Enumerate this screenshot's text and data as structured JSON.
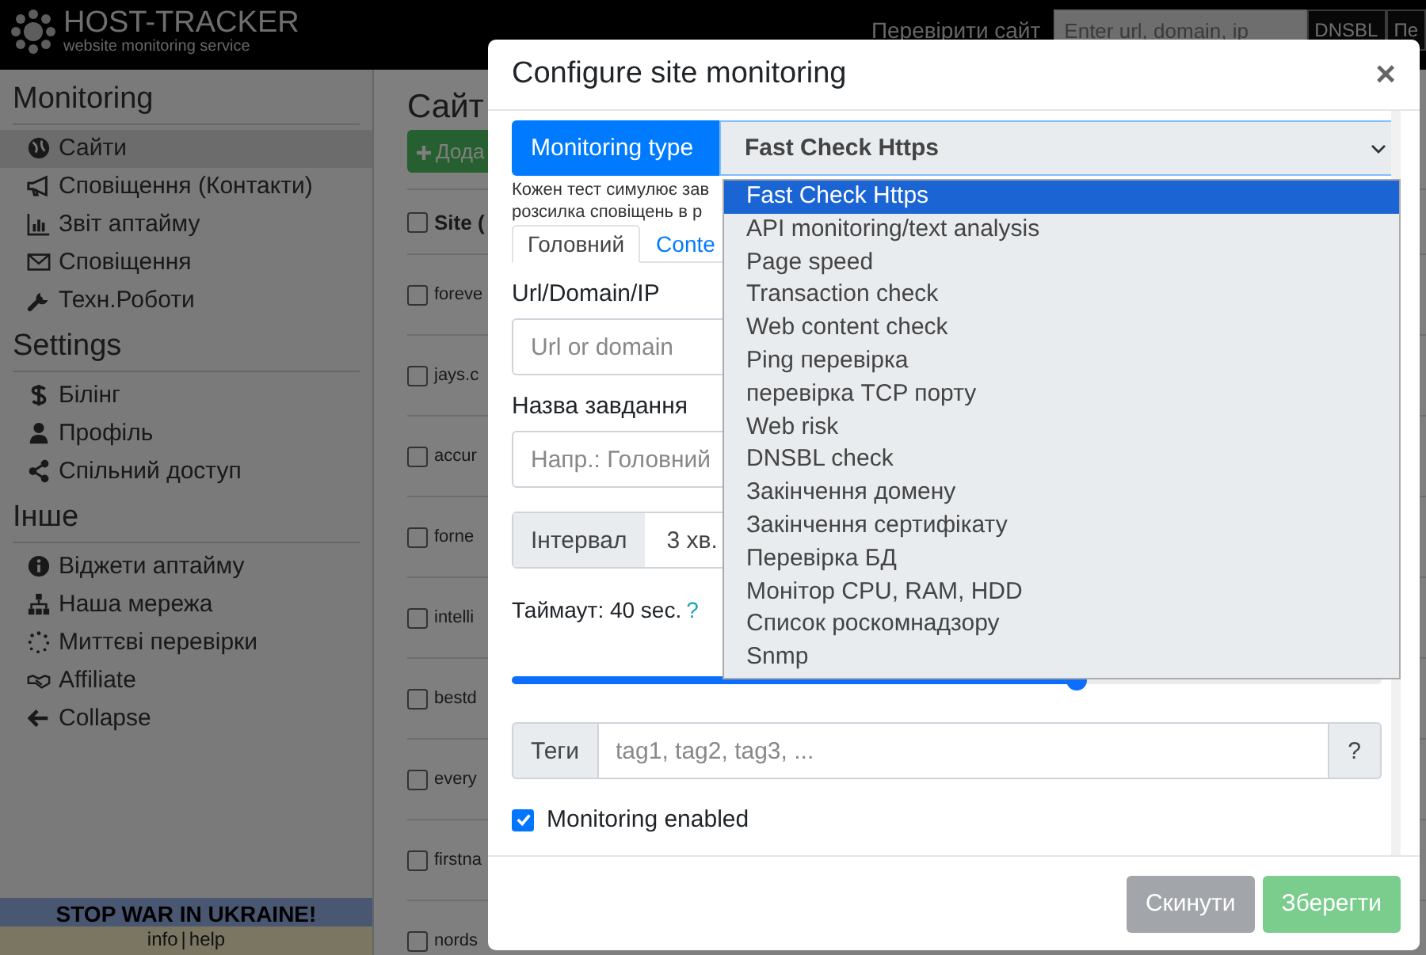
{
  "header": {
    "logo_title": "HOST-TRACKER",
    "logo_subtitle": "website monitoring service",
    "check_label": "Перевірити сайт",
    "check_placeholder": "Enter url, domain, ip",
    "buttons": [
      "DNSBL",
      "Пе"
    ]
  },
  "sidebar": {
    "sections": [
      {
        "title": "Monitoring",
        "items": [
          {
            "label": "Сайти",
            "selected": true
          },
          {
            "label": "Сповіщення (Контакти)",
            "selected": false
          },
          {
            "label": "Звіт аптайму",
            "selected": false
          },
          {
            "label": "Сповіщення",
            "selected": false
          },
          {
            "label": "Техн.Роботи",
            "selected": false
          }
        ]
      },
      {
        "title": "Settings",
        "items": [
          {
            "label": "Білінг",
            "selected": false
          },
          {
            "label": "Профіль",
            "selected": false
          },
          {
            "label": "Спільний доступ",
            "selected": false
          }
        ]
      },
      {
        "title": "Інше",
        "items": [
          {
            "label": "Віджети аптайму",
            "selected": false
          },
          {
            "label": "Наша мережа",
            "selected": false
          },
          {
            "label": "Миттєві перевірки",
            "selected": false
          },
          {
            "label": "Affiliate",
            "selected": false
          },
          {
            "label": "Collapse",
            "selected": false
          }
        ]
      }
    ],
    "banner": {
      "title": "STOP WAR IN UKRAINE!",
      "links": [
        "info",
        "help"
      ],
      "separator": "|"
    }
  },
  "main": {
    "title": "Сайт",
    "add_button": "Дода",
    "column": "Site (",
    "all_checked": false,
    "rows": [
      {
        "site": "foreve",
        "checked": false
      },
      {
        "site": "jays.c",
        "checked": false
      },
      {
        "site": "accur",
        "checked": false
      },
      {
        "site": "forne",
        "checked": false
      },
      {
        "site": "intelli",
        "checked": false
      },
      {
        "site": "bestd",
        "checked": false
      },
      {
        "site": "every",
        "checked": false
      },
      {
        "site": "firstna",
        "checked": false
      },
      {
        "site": "nords",
        "checked": false
      }
    ]
  },
  "modal": {
    "title": "Configure site monitoring",
    "close": "×",
    "type_label": "Monitoring type",
    "type_value": "Fast Check Https",
    "help_lines": [
      "Кожен тест симулює зав",
      "розсилка сповіщень в р"
    ],
    "tabs": [
      {
        "label": "Головний",
        "selected": true
      },
      {
        "label": "Conte",
        "selected": false
      }
    ],
    "url_label": "Url/Domain/IP",
    "url_placeholder": "Url or domain",
    "name_label": "Назва завдання",
    "name_placeholder": "Напр.: Головний",
    "interval_label": "Інтервал",
    "interval_value": "3 хв.",
    "timeout_label": "Таймаут: 40 sec.",
    "timeout_help": "?",
    "timeout_slider": {
      "level": 0.65
    },
    "tags_label": "Теги",
    "tags_placeholder": "tag1, tag2, tag3, ...",
    "tags_help": "?",
    "monitoring_enabled": {
      "label": "Monitoring enabled",
      "checked": true
    },
    "buttons": [
      {
        "label": "Скинути",
        "kind": "secondary"
      },
      {
        "label": "Зберегти",
        "kind": "success"
      }
    ],
    "dropdown": {
      "options": [
        {
          "label": "Fast Check Https",
          "selected": true
        },
        {
          "label": "API monitoring/text analysis",
          "selected": false
        },
        {
          "label": "Page speed",
          "selected": false
        },
        {
          "label": "Transaction check",
          "selected": false
        },
        {
          "label": "Web content check",
          "selected": false
        },
        {
          "label": "Ping перевірка",
          "selected": false
        },
        {
          "label": "перевірка TCP порту",
          "selected": false
        },
        {
          "label": "Web risk",
          "selected": false
        },
        {
          "label": "DNSBL check",
          "selected": false
        },
        {
          "label": "Закінчення домену",
          "selected": false
        },
        {
          "label": "Закінчення сертифікату",
          "selected": false
        },
        {
          "label": "Перевірка БД",
          "selected": false
        },
        {
          "label": "Монітор CPU, RAM, HDD",
          "selected": false
        },
        {
          "label": "Список роскомнадзору",
          "selected": false
        },
        {
          "label": "Snmp",
          "selected": false
        }
      ]
    }
  }
}
